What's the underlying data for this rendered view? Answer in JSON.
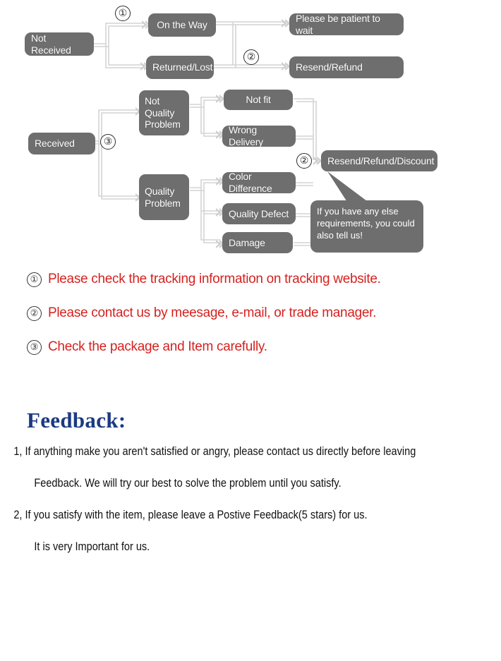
{
  "diagram": {
    "nodes": [
      {
        "id": "not-received",
        "label": "Not Received"
      },
      {
        "id": "on-the-way",
        "label": "On the Way"
      },
      {
        "id": "returned-lost",
        "label": "Returned/Lost"
      },
      {
        "id": "please-be-patient",
        "label": "Please be patient to wait"
      },
      {
        "id": "resend-refund",
        "label": "Resend/Refund"
      },
      {
        "id": "received",
        "label": "Received"
      },
      {
        "id": "not-quality-problem",
        "label": "Not\nQuality\nProblem"
      },
      {
        "id": "quality-problem",
        "label": "Quality\nProblem"
      },
      {
        "id": "not-fit",
        "label": "Not fit"
      },
      {
        "id": "wrong-delivery",
        "label": "Wrong Delivery"
      },
      {
        "id": "color-difference",
        "label": "Color Difference"
      },
      {
        "id": "quality-defect",
        "label": "Quality Defect"
      },
      {
        "id": "damage",
        "label": "Damage"
      },
      {
        "id": "resend-refund-discount",
        "label": "Resend/Refund/Discount"
      }
    ],
    "markers": {
      "one_top": "①",
      "two_top": "②",
      "three_mid": "③",
      "two_mid": "②"
    },
    "callout": "If you have any else\nrequirements, you could\nalso tell us!",
    "colors": {
      "node_fill": "#6e6e6e",
      "node_text": "#ffffff",
      "connector": "#d2d2d2"
    }
  },
  "notes": [
    {
      "marker": "①",
      "text": "Please check the tracking information on tracking website."
    },
    {
      "marker": "②",
      "text": "Please contact us by meesage, e-mail, or trade manager."
    },
    {
      "marker": "③",
      "text": "Check the package and Item carefully."
    }
  ],
  "notes_color": "#d5221f",
  "feedback": {
    "title": "Feedback:",
    "title_color": "#1b3a82",
    "lines": [
      "1, If anything make you aren't satisfied or angry, please contact us directly before leaving",
      "Feedback. We will try our best to solve the problem until you satisfy.",
      "2, If you satisfy with the item, please leave a Postive Feedback(5 stars) for us.",
      "It is very Important for us."
    ]
  }
}
